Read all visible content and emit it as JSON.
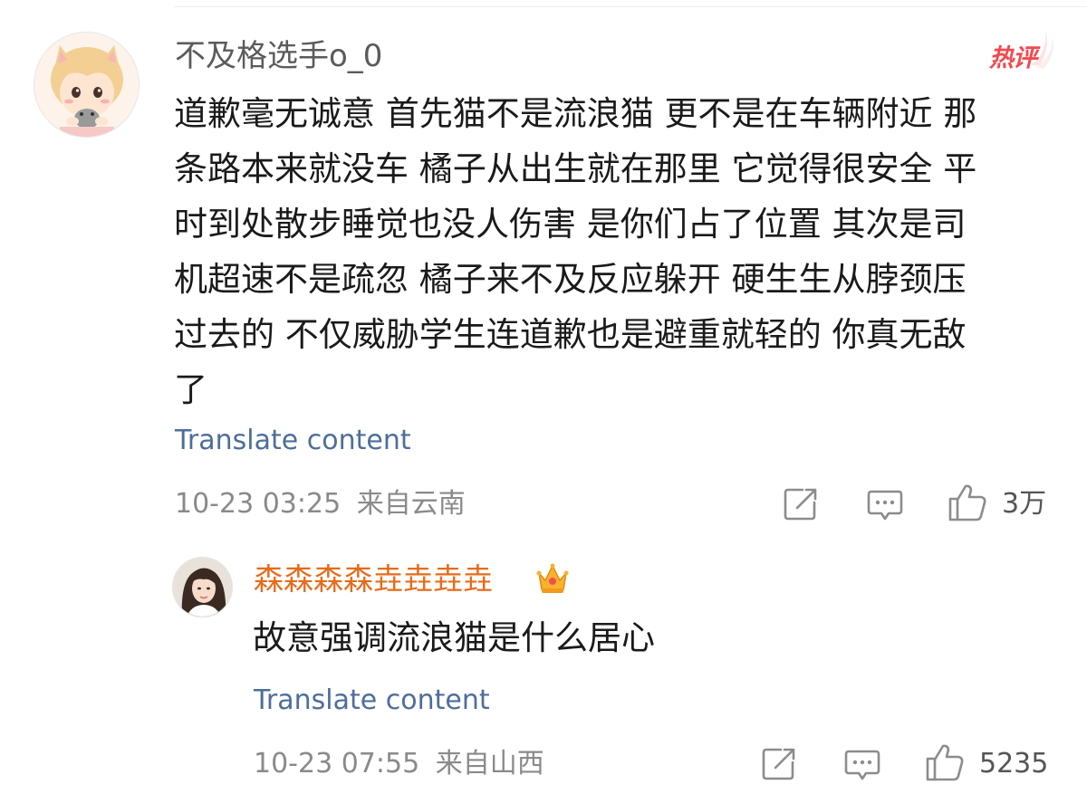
{
  "main_comment": {
    "username": "不及格选手o_0",
    "hot_badge": "热评",
    "lines": [
      "道歉毫无诚意 首先猫不是流浪猫 更不是在车辆附近 那",
      "条路本来就没车 橘子从出生就在那里 它觉得很安全 平",
      "时到处散步睡觉也没人伤害 是你们占了位置 其次是司",
      "机超速不是疏忽 橘子来不及反应躲开 硬生生从脖颈压",
      "过去的 不仅威胁学生连道歉也是避重就轻的 你真无敌",
      "了"
    ],
    "translate": "Translate content",
    "timestamp": "10-23 03:25",
    "location": "来自云南",
    "like_count": "3万"
  },
  "reply": {
    "username": "森森森森垚垚垚垚",
    "text": "故意强调流浪猫是什么居心",
    "translate": "Translate content",
    "timestamp": "10-23 07:55",
    "location": "来自山西",
    "like_count": "5235"
  },
  "colors": {
    "link": "#4e6e9a",
    "reply_username": "#e66b1a",
    "hot_badge": "#f24a4f",
    "meta_gray": "#8a8a8a"
  },
  "icons": [
    "share-icon",
    "comment-icon",
    "like-icon",
    "crown-icon"
  ]
}
